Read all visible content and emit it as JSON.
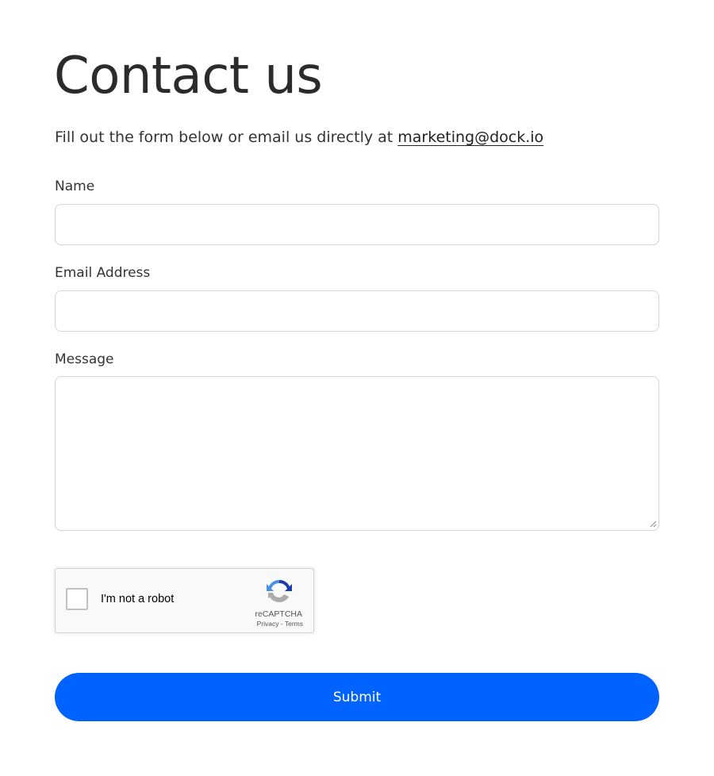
{
  "page": {
    "title": "Contact us",
    "intro_prefix": "Fill out the form below or email us directly at ",
    "email_link": "marketing@dock.io"
  },
  "form": {
    "name_label": "Name",
    "name_value": "",
    "email_label": "Email Address",
    "email_value": "",
    "message_label": "Message",
    "message_value": "",
    "submit_label": "Submit"
  },
  "recaptcha": {
    "label": "I'm not a robot",
    "brand": "reCAPTCHA",
    "privacy": "Privacy",
    "separator": " - ",
    "terms": "Terms",
    "logo_icon": "recaptcha-logo-icon"
  },
  "colors": {
    "accent": "#0062ff",
    "text": "#2b2b2b",
    "border": "#d4d4d4"
  }
}
